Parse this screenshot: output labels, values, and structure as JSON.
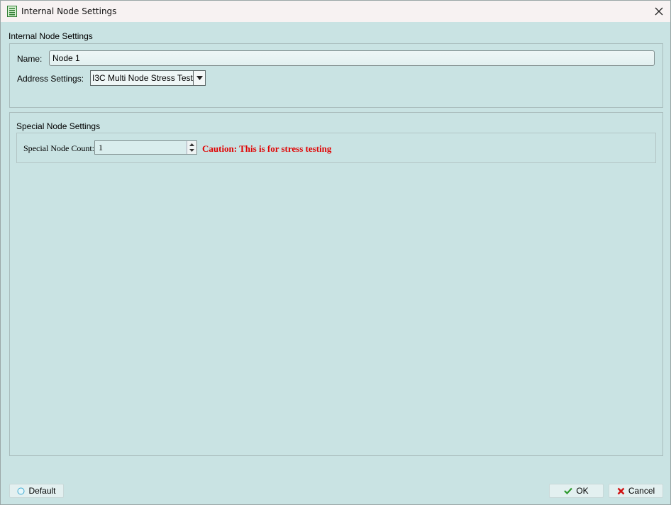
{
  "window": {
    "title": "Internal Node Settings"
  },
  "internal": {
    "section_title": "Internal Node Settings",
    "name_label": "Name:",
    "name_value": "Node 1",
    "address_label": "Address Settings:",
    "address_value": "I3C Multi Node Stress Test"
  },
  "special": {
    "section_title": "Special Node Settings",
    "count_label": "Special Node Count:",
    "count_value": "1",
    "caution": "Caution: This is for stress testing"
  },
  "footer": {
    "default_label": "Default",
    "ok_label": "OK",
    "cancel_label": "Cancel"
  },
  "colors": {
    "background": "#c9e3e3",
    "caution": "#e00000",
    "ok_check": "#2e9a2e",
    "cancel_x": "#d01010"
  },
  "icons": {
    "app": "document-icon",
    "close": "close-icon",
    "dropdown": "triangle-down-icon",
    "default": "circle-icon",
    "ok": "check-icon",
    "cancel": "x-icon"
  }
}
